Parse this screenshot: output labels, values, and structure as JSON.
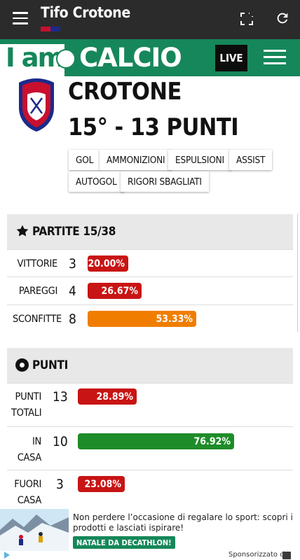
{
  "app": {
    "title": "Tifo Crotone"
  },
  "colors": {
    "flag": [
      "#c8102e",
      "#1c2a8a"
    ],
    "brand_green": "#16875a",
    "red": "#c81414",
    "orange": "#f07d00",
    "green": "#1e8c28"
  },
  "brand": {
    "logo_left": "I am",
    "logo_right": "CALCIO",
    "live": "LIVE"
  },
  "team": {
    "name": "CROTONE",
    "rank": "15° - 13 PUNTI",
    "crest_text": "F.C. CROTONE"
  },
  "tags": [
    {
      "label": "GOL"
    },
    {
      "label": "AMMONIZIONI"
    },
    {
      "label": "ESPULSIONI"
    },
    {
      "label": "ASSIST"
    },
    {
      "label": "AUTOGOL"
    },
    {
      "label": "RIGORI SBAGLIATI"
    }
  ],
  "matches": {
    "title": "PARTITE 15/38",
    "rows": [
      {
        "label": "VITTORIE",
        "count": "3",
        "pct": "20.00%",
        "value": 20.0,
        "color": "red"
      },
      {
        "label": "PAREGGI",
        "count": "4",
        "pct": "26.67%",
        "value": 26.67,
        "color": "red"
      },
      {
        "label": "SCONFITTE",
        "count": "8",
        "pct": "53.33%",
        "value": 53.33,
        "color": "orange"
      }
    ]
  },
  "points": {
    "title": "PUNTI",
    "rows": [
      {
        "label1": "PUNTI",
        "label2": "TOTALI",
        "count": "13",
        "pct": "28.89%",
        "value": 28.89,
        "color": "red"
      },
      {
        "label1": "IN",
        "label2": "CASA",
        "count": "10",
        "pct": "76.92%",
        "value": 76.92,
        "color": "green"
      },
      {
        "label1": "FUORI",
        "label2": "CASA",
        "count": "3",
        "pct": "23.08%",
        "value": 23.08,
        "color": "red"
      }
    ]
  },
  "ad": {
    "text": "Non perdere l’occasione di regalare lo sport: scopri i prodotti e lasciati ispirare!",
    "cta": "NATALE DA DECATHLON!",
    "sponsor": "Sponsorizzato da"
  }
}
